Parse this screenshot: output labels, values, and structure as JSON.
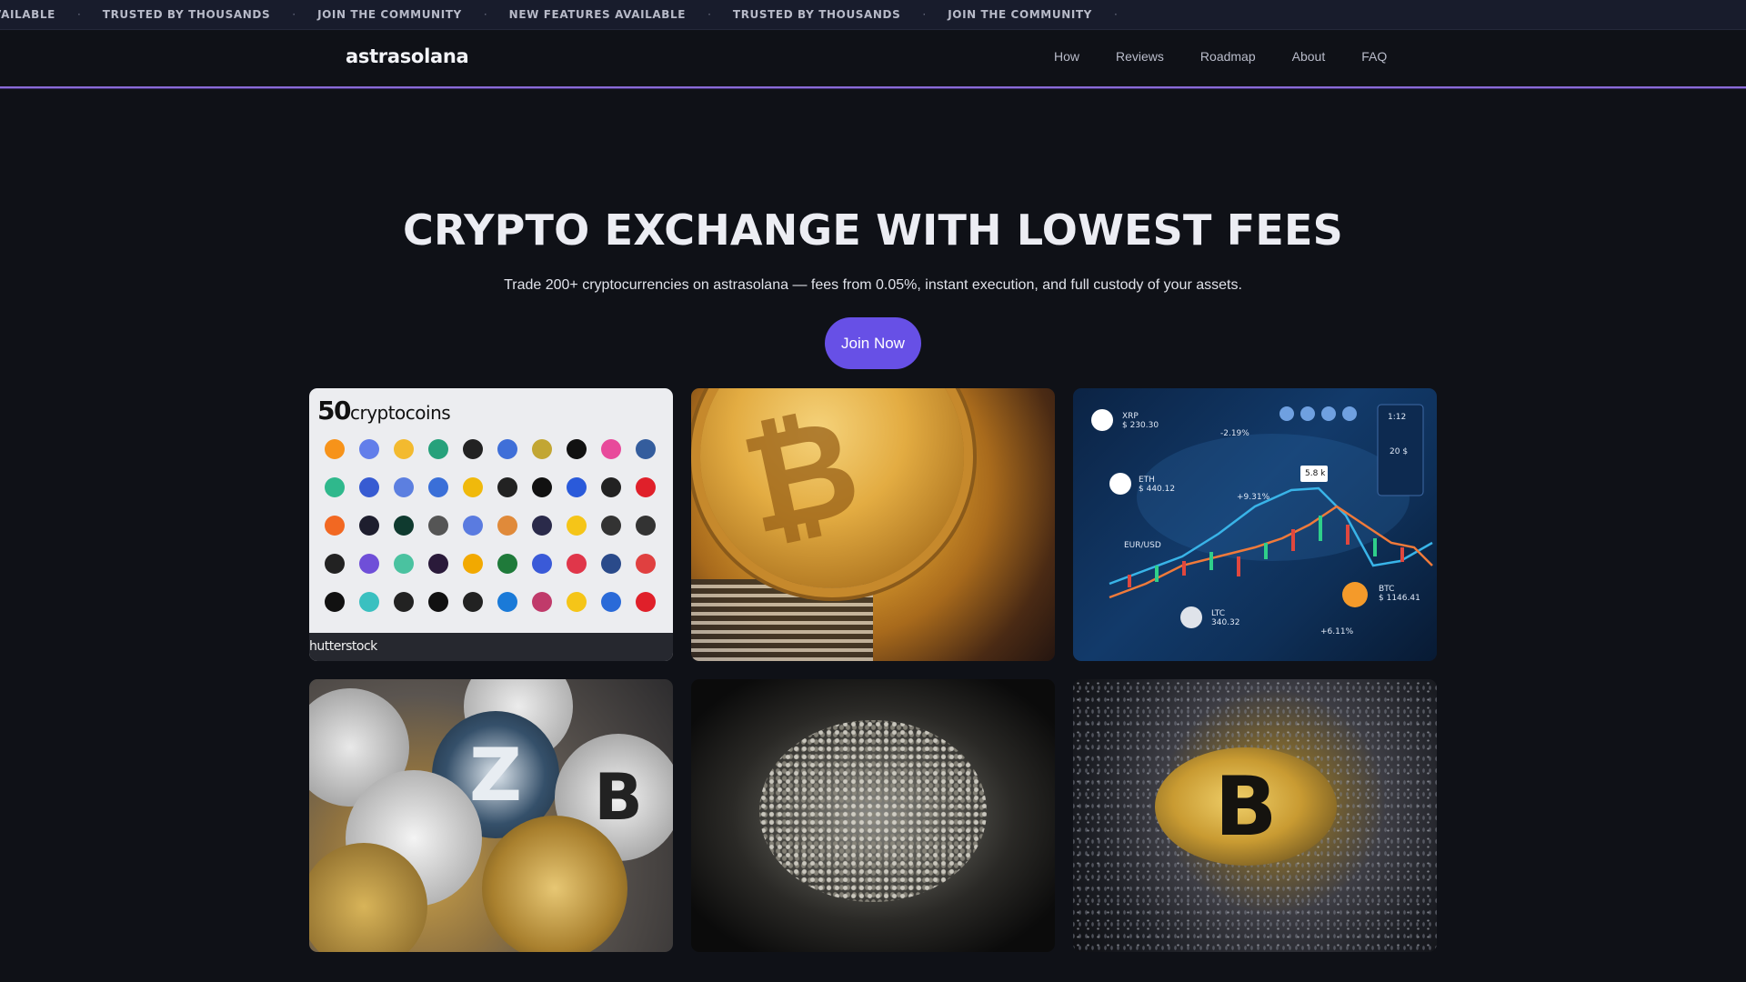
{
  "ticker": {
    "items": [
      "NEW FEATURES AVAILABLE",
      "TRUSTED BY THOUSANDS",
      "JOIN THE COMMUNITY",
      "NEW FEATURES AVAILABLE",
      "TRUSTED BY THOUSANDS",
      "JOIN THE COMMUNITY"
    ],
    "first_visible_fragment": "VAILABLE"
  },
  "nav": {
    "brand": "astrasolana",
    "links": [
      "How",
      "Reviews",
      "Roadmap",
      "About",
      "FAQ"
    ]
  },
  "hero": {
    "title": "CRYPTO EXCHANGE WITH LOWEST FEES",
    "subtitle": "Trade 200+ cryptocurrencies on astrasolana — fees from 0.05%, instant execution, and full custody of your assets.",
    "cta_label": "Join Now"
  },
  "gallery": {
    "tile1": {
      "count": "50",
      "title": "cryptocoins",
      "footer": "hutterstock"
    },
    "tile2": {
      "symbol": "₿"
    },
    "tile3": {
      "xrp": "XRP",
      "xrp_price": "$ 230.30",
      "eth": "ETH",
      "eth_price": "$ 440.12",
      "ltc": "LTC",
      "ltc_price": "340.32",
      "btc": "BTC",
      "btc_price": "$ 1146.41",
      "eurusd": "EUR/USD",
      "pct1": "-2.19%",
      "pct2": "+9.31%",
      "pct3": "+6.11%",
      "tooltip": "5.8 k",
      "ratio": "1:12",
      "val": "20 $"
    },
    "tile4": {
      "z": "Z",
      "b": "B"
    },
    "tile6": {
      "symbol": "B"
    }
  },
  "colors": {
    "accent": "#6750e6",
    "nav_underline": "#8a6bd8",
    "background": "#0f1117",
    "ticker_bg": "#181c2c"
  }
}
